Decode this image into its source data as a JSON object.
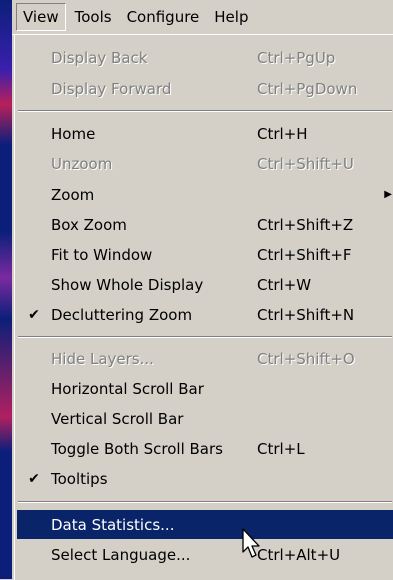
{
  "menubar": {
    "items": [
      {
        "label": "View"
      },
      {
        "label": "Tools"
      },
      {
        "label": "Configure"
      },
      {
        "label": "Help"
      }
    ]
  },
  "menu": {
    "items": [
      {
        "label": "Display Back",
        "shortcut": "Ctrl+PgUp",
        "disabled": true
      },
      {
        "label": "Display Forward",
        "shortcut": "Ctrl+PgDown",
        "disabled": true
      },
      {
        "label": "Home",
        "shortcut": "Ctrl+H"
      },
      {
        "label": "Unzoom",
        "shortcut": "Ctrl+Shift+U",
        "disabled": true
      },
      {
        "label": "Zoom",
        "shortcut": "",
        "submenu": true
      },
      {
        "label": "Box Zoom",
        "shortcut": "Ctrl+Shift+Z"
      },
      {
        "label": "Fit to Window",
        "shortcut": "Ctrl+Shift+F"
      },
      {
        "label": "Show Whole Display",
        "shortcut": "Ctrl+W"
      },
      {
        "label": "Decluttering Zoom",
        "shortcut": "Ctrl+Shift+N",
        "checked": true
      },
      {
        "label": "Hide Layers...",
        "shortcut": "Ctrl+Shift+O",
        "disabled": true
      },
      {
        "label": "Horizontal Scroll Bar",
        "shortcut": ""
      },
      {
        "label": "Vertical Scroll Bar",
        "shortcut": ""
      },
      {
        "label": "Toggle Both Scroll Bars",
        "shortcut": "Ctrl+L"
      },
      {
        "label": "Tooltips",
        "shortcut": "",
        "checked": true
      },
      {
        "label": "Data Statistics...",
        "shortcut": "",
        "selected": true
      },
      {
        "label": "Select Language...",
        "shortcut": "Ctrl+Alt+U"
      }
    ]
  },
  "glyphs": {
    "check": "✔",
    "submenu_arrow": "▶"
  },
  "colors": {
    "highlight": "#0a246a",
    "menu_bg": "#d4d0c8",
    "disabled_text": "#808080"
  }
}
